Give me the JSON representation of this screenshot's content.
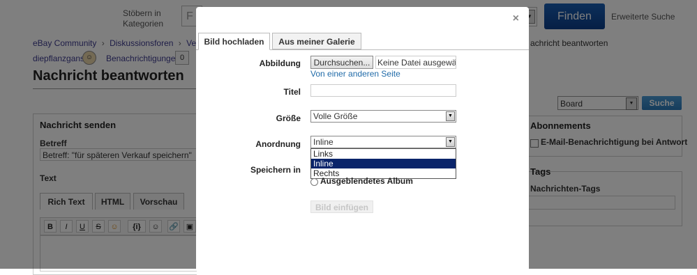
{
  "header": {
    "browse_label": "Stöbern in Kategorien",
    "search_placeholder": "F",
    "finden_label": "Finden",
    "advanced_search": "Erweiterte Suche"
  },
  "breadcrumb": {
    "items": [
      "eBay Community",
      "Diskussionsforen",
      "Verkauf"
    ],
    "tail": "achricht beantworten"
  },
  "user": {
    "name": "diepflanzgans",
    "notifications_label": "Benachrichtigungen",
    "notifications_count": "0"
  },
  "page": {
    "title": "Nachricht beantworten"
  },
  "board_search": {
    "select_value": "Board",
    "button_label": "Suche"
  },
  "compose": {
    "section_title": "Nachricht senden",
    "subject_label": "Betreff",
    "subject_value": "Betreff: \"für späteren Verkauf speichern\"",
    "text_label": "Text",
    "tabs": [
      "Rich Text",
      "HTML",
      "Vorschau"
    ],
    "toolbar": [
      "B",
      "I",
      "U",
      "S",
      "☺",
      "{i}",
      "☺",
      "🔗",
      "▣"
    ]
  },
  "subscriptions": {
    "title": "Abonnements",
    "email_label": "E-Mail-Benachrichtigung bei Antwort"
  },
  "tags": {
    "title": "Tags",
    "label": "Nachrichten-Tags"
  },
  "modal": {
    "close": "×",
    "tabs": [
      "Bild hochladen",
      "Aus meiner Galerie"
    ],
    "image_label": "Abbildung",
    "browse_button": "Durchsuchen...",
    "no_file": "Keine Datei ausgewählt.",
    "other_page_link": "Von einer anderen Seite",
    "title_label": "Titel",
    "size_label": "Größe",
    "size_value": "Volle Größe",
    "align_label": "Anordnung",
    "align_value": "Inline",
    "align_options": [
      "Links",
      "Inline",
      "Rechts"
    ],
    "save_label": "Speichern in",
    "hidden_album": "Ausgeblendetes Album",
    "insert_button": "Bild einfügen"
  },
  "colors": {
    "overlay": "rgba(0,0,0,0.5)",
    "primary_button": "#1a5fb4",
    "link": "#1f6aa8",
    "dropdown_highlight": "#0a246a"
  }
}
